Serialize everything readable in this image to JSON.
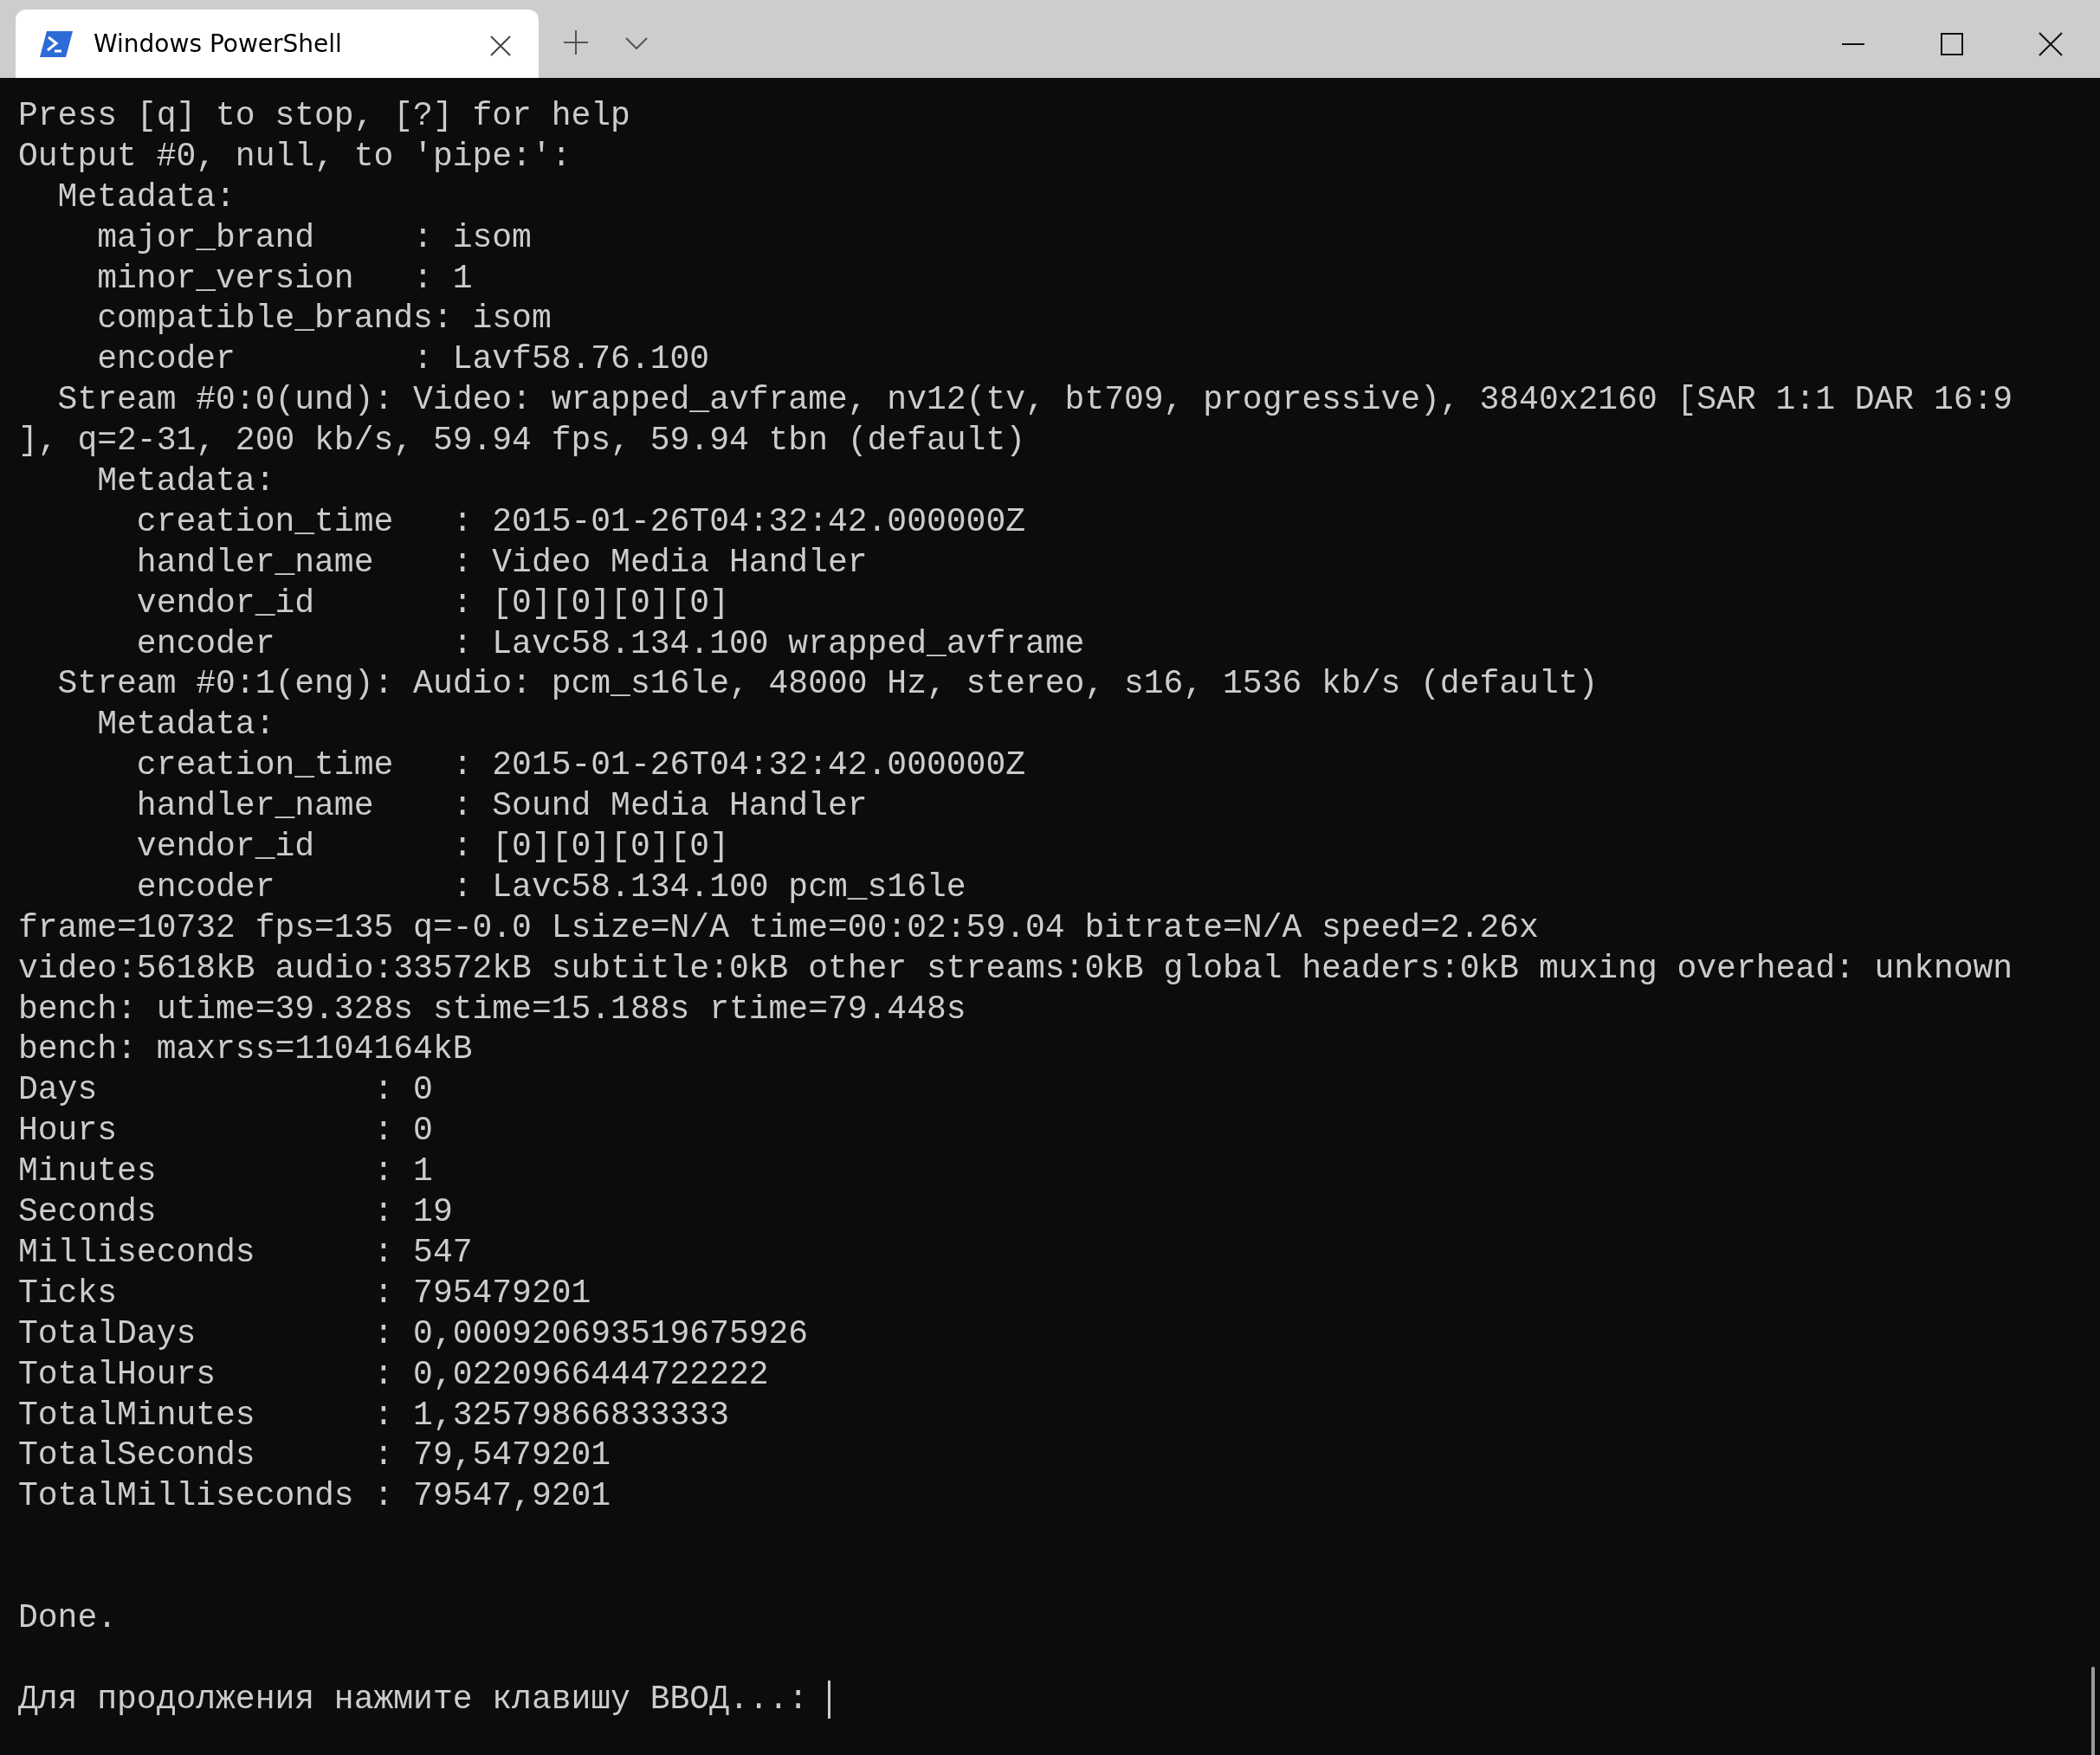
{
  "tabs": [
    {
      "title": "Windows PowerShell",
      "selected": true
    }
  ],
  "terminal": {
    "output_lines": [
      "Press [q] to stop, [?] for help",
      "Output #0, null, to 'pipe:':",
      "  Metadata:",
      "    major_brand     : isom",
      "    minor_version   : 1",
      "    compatible_brands: isom",
      "    encoder         : Lavf58.76.100",
      "  Stream #0:0(und): Video: wrapped_avframe, nv12(tv, bt709, progressive), 3840x2160 [SAR 1:1 DAR 16:9",
      "], q=2-31, 200 kb/s, 59.94 fps, 59.94 tbn (default)",
      "    Metadata:",
      "      creation_time   : 2015-01-26T04:32:42.000000Z",
      "      handler_name    : Video Media Handler",
      "      vendor_id       : [0][0][0][0]",
      "      encoder         : Lavc58.134.100 wrapped_avframe",
      "  Stream #0:1(eng): Audio: pcm_s16le, 48000 Hz, stereo, s16, 1536 kb/s (default)",
      "    Metadata:",
      "      creation_time   : 2015-01-26T04:32:42.000000Z",
      "      handler_name    : Sound Media Handler",
      "      vendor_id       : [0][0][0][0]",
      "      encoder         : Lavc58.134.100 pcm_s16le",
      "frame=10732 fps=135 q=-0.0 Lsize=N/A time=00:02:59.04 bitrate=N/A speed=2.26x",
      "video:5618kB audio:33572kB subtitle:0kB other streams:0kB global headers:0kB muxing overhead: unknown",
      "bench: utime=39.328s stime=15.188s rtime=79.448s",
      "bench: maxrss=1104164kB",
      "Days              : 0",
      "Hours             : 0",
      "Minutes           : 1",
      "Seconds           : 19",
      "Milliseconds      : 547",
      "Ticks             : 795479201",
      "TotalDays         : 0,000920693519675926",
      "TotalHours        : 0,0220966444722222",
      "TotalMinutes      : 1,32579866833333",
      "TotalSeconds      : 79,5479201",
      "TotalMilliseconds : 79547,9201"
    ],
    "status_line": "Done.",
    "prompt": "Для продолжения нажмите клавишу ВВОД...: "
  }
}
